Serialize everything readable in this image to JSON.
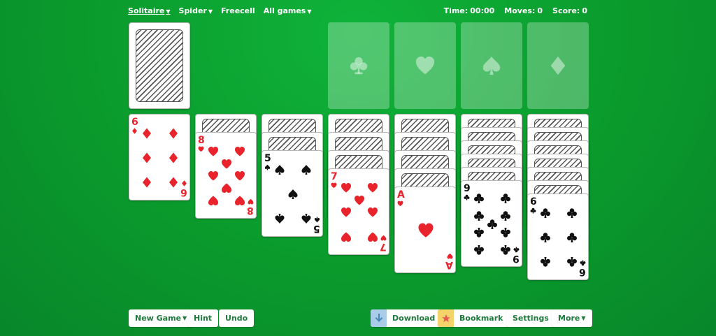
{
  "nav": {
    "items": [
      {
        "label": "Solitaire",
        "has_dropdown": true,
        "active": true
      },
      {
        "label": "Spider",
        "has_dropdown": true,
        "active": false
      },
      {
        "label": "Freecell",
        "has_dropdown": false,
        "active": false
      },
      {
        "label": "All games",
        "has_dropdown": true,
        "active": false
      }
    ]
  },
  "stats": {
    "time_label": "Time:",
    "time_value": "00:00",
    "moves_label": "Moves:",
    "moves_value": "0",
    "score_label": "Score:",
    "score_value": "0"
  },
  "stock": {
    "face_down": true
  },
  "foundations": [
    {
      "suit": "club"
    },
    {
      "suit": "heart"
    },
    {
      "suit": "spade"
    },
    {
      "suit": "diamond"
    }
  ],
  "tableau": [
    {
      "hidden_count": 0,
      "top": {
        "rank": "6",
        "suit": "diamond",
        "color": "red"
      }
    },
    {
      "hidden_count": 1,
      "top": {
        "rank": "8",
        "suit": "heart",
        "color": "red"
      }
    },
    {
      "hidden_count": 2,
      "top": {
        "rank": "5",
        "suit": "spade",
        "color": "black"
      }
    },
    {
      "hidden_count": 3,
      "top": {
        "rank": "7",
        "suit": "heart",
        "color": "red"
      }
    },
    {
      "hidden_count": 4,
      "top": {
        "rank": "A",
        "suit": "heart",
        "color": "red"
      }
    },
    {
      "hidden_count": 5,
      "top": {
        "rank": "9",
        "suit": "club",
        "color": "black"
      }
    },
    {
      "hidden_count": 6,
      "top": {
        "rank": "6",
        "suit": "club",
        "color": "black"
      }
    }
  ],
  "buttons": {
    "new_game": "New Game",
    "hint": "Hint",
    "undo": "Undo",
    "download": "Download",
    "bookmark": "Bookmark",
    "settings": "Settings",
    "more": "More"
  },
  "colors": {
    "felt": "#0a9a2c",
    "red_suit": "#e8232b",
    "black_suit": "#111111",
    "button_text": "#1d7a3a"
  }
}
